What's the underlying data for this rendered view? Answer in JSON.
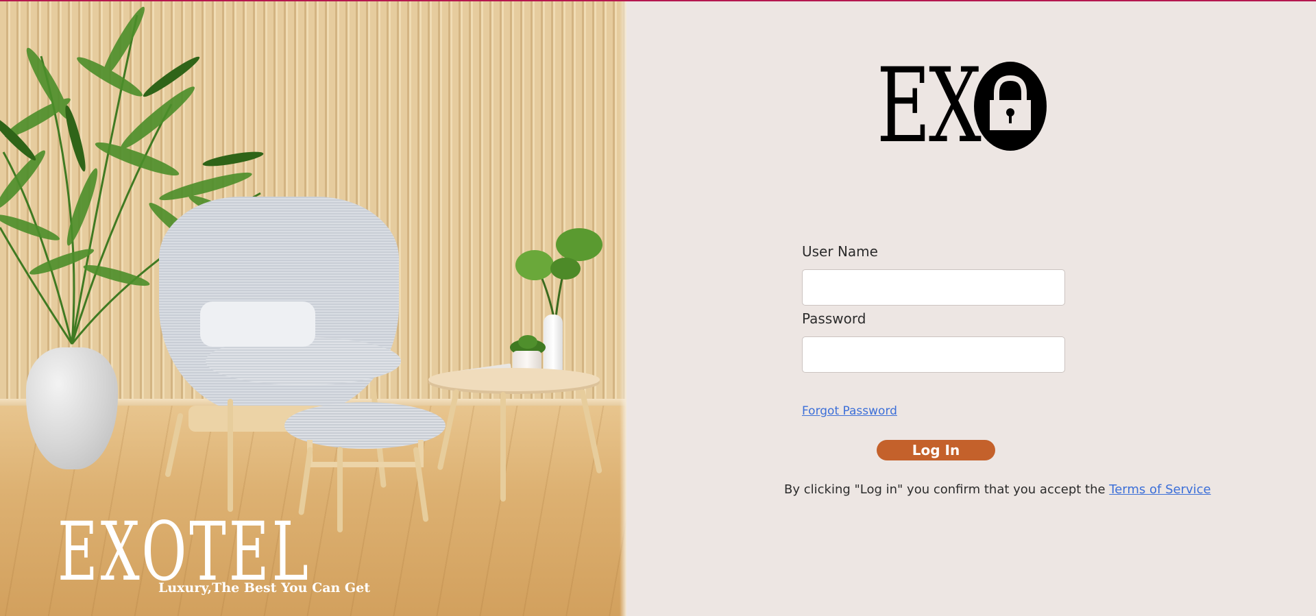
{
  "hero": {
    "brand": "EXOTEL",
    "tagline": "Luxury,The Best You Can Get"
  },
  "logo": {
    "text": "EX",
    "lock_icon": "padlock-icon"
  },
  "form": {
    "username_label": "User Name",
    "username_value": "",
    "password_label": "Password",
    "password_value": "",
    "forgot_password": "Forgot Password",
    "login_button": "Log In"
  },
  "terms": {
    "prefix": "By clicking \"Log in\" you confirm that you accept the ",
    "link": "Terms of Service"
  },
  "colors": {
    "accent_line": "#b5174f",
    "button": "#c4612b",
    "link": "#3c6fd8",
    "background": "#ede6e3"
  }
}
